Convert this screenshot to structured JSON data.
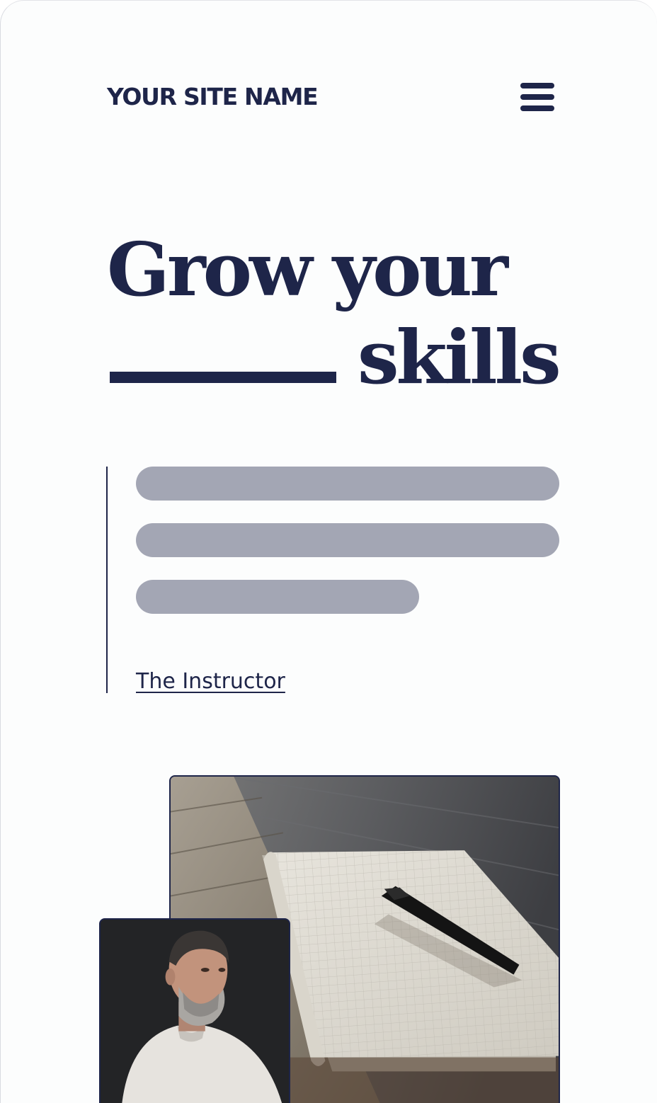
{
  "header": {
    "site_name": "YOUR SITE NAME",
    "menu_icon": "hamburger-menu-icon"
  },
  "hero": {
    "headline_line1": "Grow your",
    "headline_line2_word": "skills"
  },
  "quote": {
    "author_link": "The Instructor"
  },
  "images": {
    "notebook": "notebook-with-pen-photo",
    "instructor": "instructor-portrait-photo"
  },
  "colors": {
    "primary": "#1e2549",
    "placeholder": "#a3a6b4",
    "background": "#fcfdfd"
  }
}
